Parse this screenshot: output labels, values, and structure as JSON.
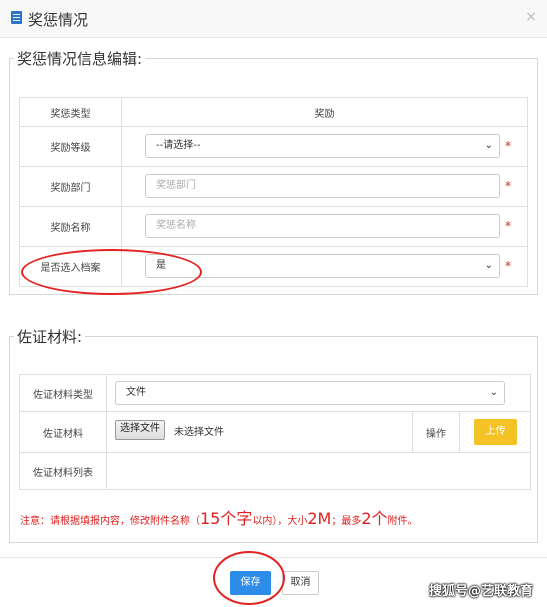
{
  "dialog": {
    "title": "奖惩情况",
    "close_symbol": "×"
  },
  "section_info": {
    "legend": "奖惩情况信息编辑:",
    "header": {
      "label": "奖惩类型",
      "value": "奖励"
    },
    "rows": [
      {
        "label": "奖励等级",
        "type": "select",
        "value": "--请选择--",
        "required": "*"
      },
      {
        "label": "奖励部门",
        "type": "input",
        "placeholder": "奖惩部门",
        "required": "*"
      },
      {
        "label": "奖励名称",
        "type": "input",
        "placeholder": "奖惩名称",
        "required": "*"
      },
      {
        "label": "是否选入档案",
        "type": "select",
        "value": "是",
        "required": "*"
      }
    ]
  },
  "section_proof": {
    "legend": "佐证材料:",
    "type_label": "佐证材料类型",
    "type_value": "文件",
    "file_label": "佐证材料",
    "file_button": "选择文件",
    "file_status": "未选择文件",
    "op_label": "操作",
    "upload_button": "上传",
    "list_label": "佐证材料列表"
  },
  "note": {
    "p1": "注意：请根据填报内容，修改附件名称（",
    "p2": "15个字",
    "p3": "以内），大小",
    "p4": "2M",
    "p5": "；最多",
    "p6": "2个",
    "p7": "附件。"
  },
  "footer": {
    "save": "保存",
    "cancel": "取消"
  },
  "watermark": "搜狐号@艺联教育",
  "colors": {
    "accent": "#2d8ce8",
    "upload": "#f5c226",
    "required": "#e02020",
    "annotation": "#e32222"
  }
}
